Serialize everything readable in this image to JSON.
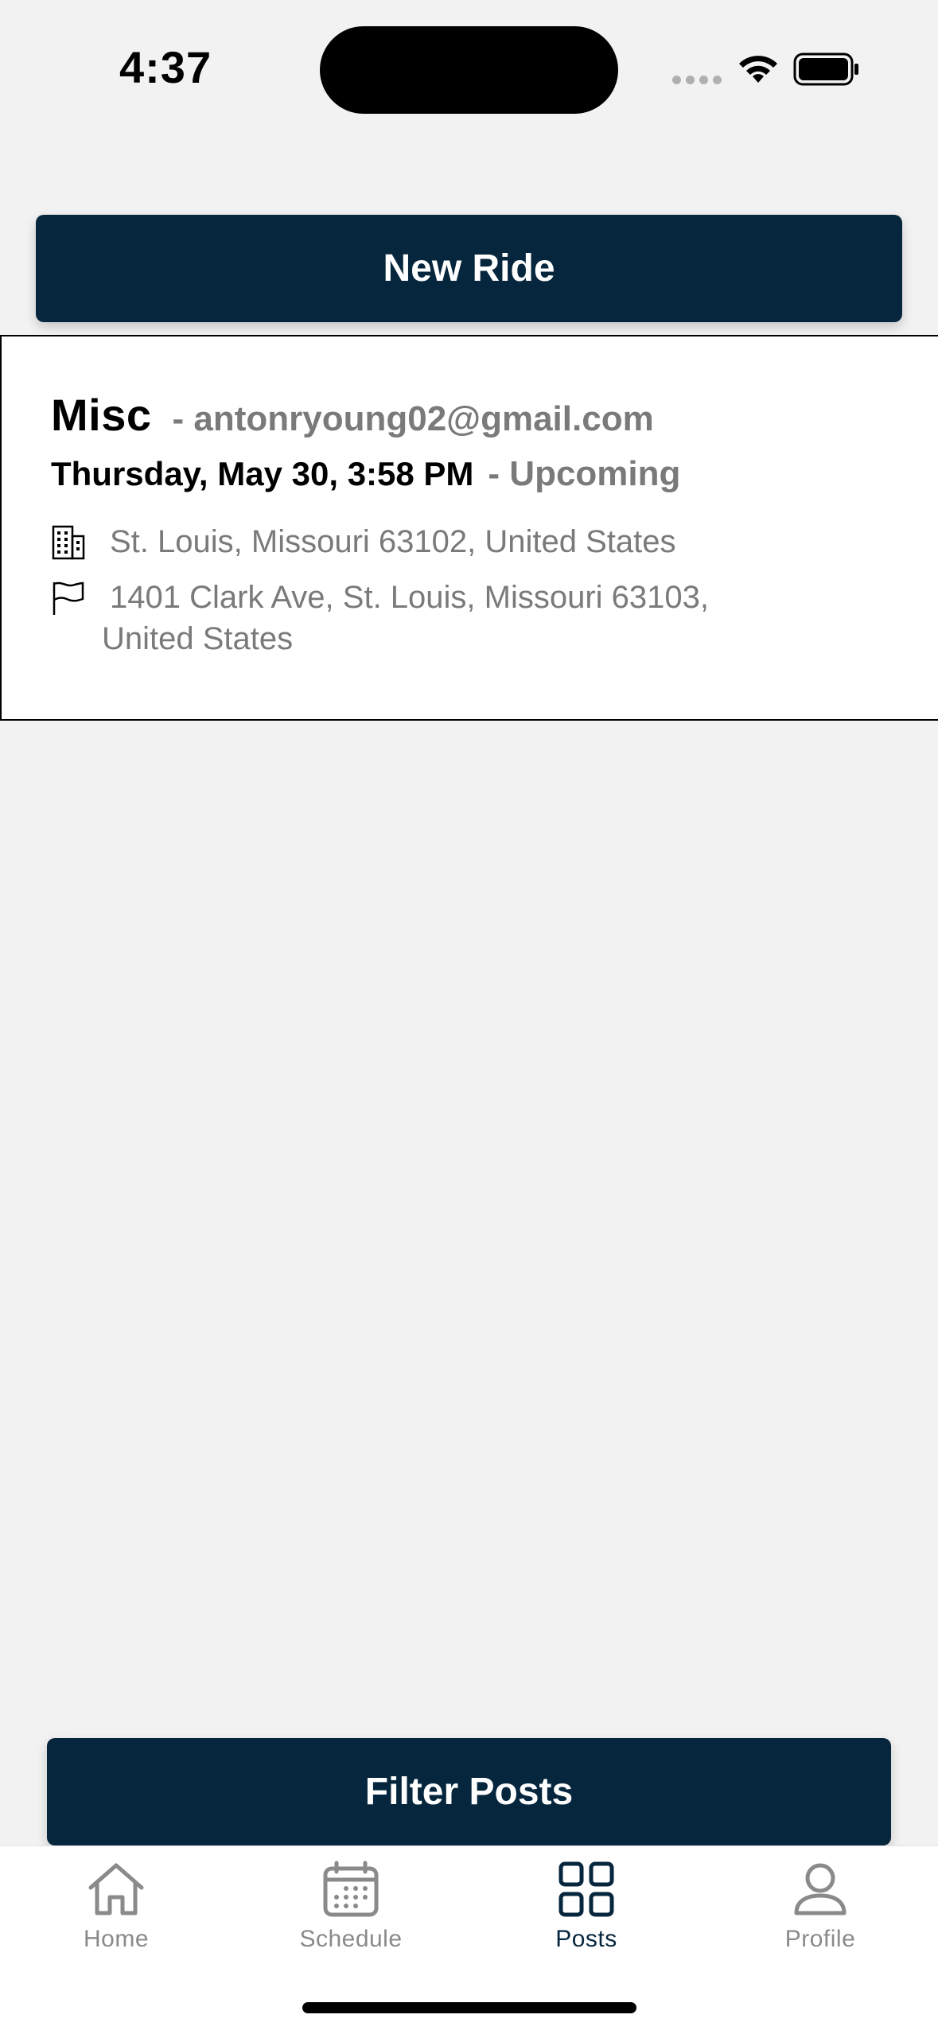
{
  "status_bar": {
    "time": "4:37",
    "icons": [
      "signal-dots-icon",
      "wifi-icon",
      "battery-icon"
    ]
  },
  "header": {
    "new_ride_label": "New Ride"
  },
  "ride": {
    "category": "Misc",
    "email": "- antonryoung02@gmail.com",
    "date": "Thursday, May 30, 3:58 PM",
    "status": "- Upcoming",
    "pickup": "St. Louis, Missouri 63102, United States",
    "dropoff_line1": "1401 Clark Ave, St. Louis, Missouri 63103,",
    "dropoff_line2": "United States",
    "icons": {
      "pickup": "building-icon",
      "dropoff": "flag-icon"
    }
  },
  "footer": {
    "filter_label": "Filter Posts"
  },
  "tabs": [
    {
      "label": "Home",
      "icon": "home-icon",
      "active": false
    },
    {
      "label": "Schedule",
      "icon": "calendar-icon",
      "active": false
    },
    {
      "label": "Posts",
      "icon": "grid-icon",
      "active": true
    },
    {
      "label": "Profile",
      "icon": "person-icon",
      "active": false
    }
  ],
  "colors": {
    "primary": "#06263d",
    "background": "#f2f2f2",
    "muted_text": "#7a7a7a",
    "inactive_tab": "#8a8a8a"
  }
}
